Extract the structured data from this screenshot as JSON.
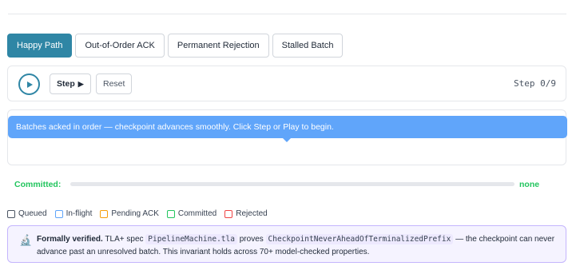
{
  "tabs": [
    {
      "label": "Happy Path",
      "active": true
    },
    {
      "label": "Out-of-Order ACK",
      "active": false
    },
    {
      "label": "Permanent Rejection",
      "active": false
    },
    {
      "label": "Stalled Batch",
      "active": false
    }
  ],
  "controls": {
    "play_icon": "play-icon",
    "step_label": "Step",
    "step_arrow": "▶",
    "reset_label": "Reset",
    "step_counter": "Step 0/9"
  },
  "banner": {
    "text": "Batches acked in order — checkpoint advances smoothly. Click Step or Play to begin."
  },
  "committed": {
    "label": "Committed:",
    "value": "none",
    "progress": 0
  },
  "legend": [
    {
      "label": "Queued",
      "color": "#4b5563"
    },
    {
      "label": "In-flight",
      "color": "#60a5fa"
    },
    {
      "label": "Pending ACK",
      "color": "#f59e0b"
    },
    {
      "label": "Committed",
      "color": "#22c55e"
    },
    {
      "label": "Rejected",
      "color": "#ef4444"
    }
  ],
  "info": {
    "icon": "microscope-icon",
    "title": "Formally verified.",
    "text_1": "TLA+ spec",
    "code_1": "PipelineMachine.tla",
    "text_2": "proves",
    "code_2": "CheckpointNeverAheadOfTerminalizedPrefix",
    "text_3": "— the checkpoint can never advance past an unresolved batch. This invariant holds across 70+ model-checked properties."
  },
  "colors": {
    "accent": "#2f86a5",
    "banner": "#60a5fa",
    "committed": "#22c55e",
    "info_border": "#c4b5fd"
  }
}
